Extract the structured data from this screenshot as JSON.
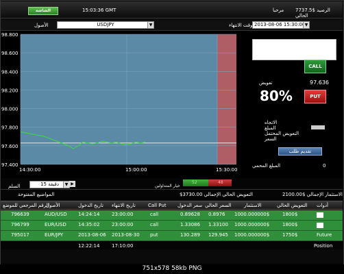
{
  "topbar": {
    "left_button": "الشاشة",
    "time": "15:03:36 GMT",
    "user_label": "مرحبا",
    "balance": "7737.5$ الرصيد الحالي"
  },
  "selectors": {
    "asset_value": "USDJPY",
    "asset_label": "الأصول",
    "expiry_value": "2013-08-06 15:30:00",
    "expiry_label": "وقت الانتهاء"
  },
  "chart_data": {
    "type": "line",
    "ylim": [
      97.4,
      98.8
    ],
    "y_ticks": [
      "98.800",
      "98.600",
      "98.400",
      "98.200",
      "98.000",
      "97.800",
      "97.600",
      "97.400"
    ],
    "x_ticks": [
      "14:30:00",
      "15:00:00",
      "15:30:00"
    ],
    "reference_line": 97.63,
    "series": [
      {
        "values": [
          97.75,
          97.74,
          97.73,
          97.72,
          97.71,
          97.7,
          97.68,
          97.66,
          97.64,
          97.62,
          97.6,
          97.57,
          97.6,
          97.64,
          97.63,
          97.62,
          97.63,
          97.65,
          97.64,
          97.63,
          97.64,
          97.62,
          97.61,
          97.62,
          97.64,
          97.63,
          97.64
        ]
      }
    ]
  },
  "trade_panel": {
    "call_label": "CALL",
    "put_label": "PUT",
    "payout_label": "تعويض",
    "payout_value": "97.636",
    "payout_percent": "80%",
    "direction_label": "الاتجاه",
    "amount_label": "المبلغ",
    "potential_payout_label": "التعويض المحتمل",
    "price_label": "السعر",
    "submit_label": "تقديم طلب",
    "received_amount_label": "المبلغ المحمي",
    "received_amount_value": "0"
  },
  "chart_controls": {
    "interval_label": "السلم",
    "interval_value": "دقيقة 15",
    "sentiment_label": "خيار المتداولين",
    "sentiment_left": "52",
    "sentiment_right": "48"
  },
  "summary": {
    "total_investment": "الاستثمار الإجمالي $2100.00",
    "total_payout": "$3730.00 التعويض الحالي الإجمالي",
    "open_positions_label": "المواضيع المفتوحة"
  },
  "table": {
    "headers": [
      "أدوات",
      "التعويض الحالي",
      "الاستثمار",
      "السعر الحالي",
      "سعر الدخول",
      "Call Put",
      "تاريخ الانتهاء",
      "تاريخ الدخول",
      "الأصول",
      "الرقم المرجعي للموضع"
    ],
    "rows": [
      {
        "tools": "",
        "payout": "1800$",
        "investment": "1000.000000$",
        "current": "0.8976",
        "entry": "0.89628",
        "type": "call",
        "expiry": "23:00:00",
        "entry_date": "14:24:14",
        "asset": "AUD/USD",
        "ref": "796639"
      },
      {
        "tools": "",
        "payout": "1800$",
        "investment": "1000.000000$",
        "current": "1.33100",
        "entry": "1.33086",
        "type": "call",
        "expiry": "23:00:00",
        "entry_date": "14:35:02",
        "asset": "EUR/USD",
        "ref": "796799"
      },
      {
        "tools": "Future",
        "payout": "1750$",
        "investment": "1000.000000$",
        "current": "129.945",
        "entry": "130.289",
        "type": "put",
        "expiry": "2013-08-30",
        "entry_date": "2013-08-06",
        "asset": "EUR/JPY",
        "ref": "795017"
      }
    ],
    "totals": {
      "position_label": "Position",
      "expiry": "17:10:00",
      "entry_date": "12:22:14"
    }
  },
  "caption": "751x578 58kb PNG"
}
